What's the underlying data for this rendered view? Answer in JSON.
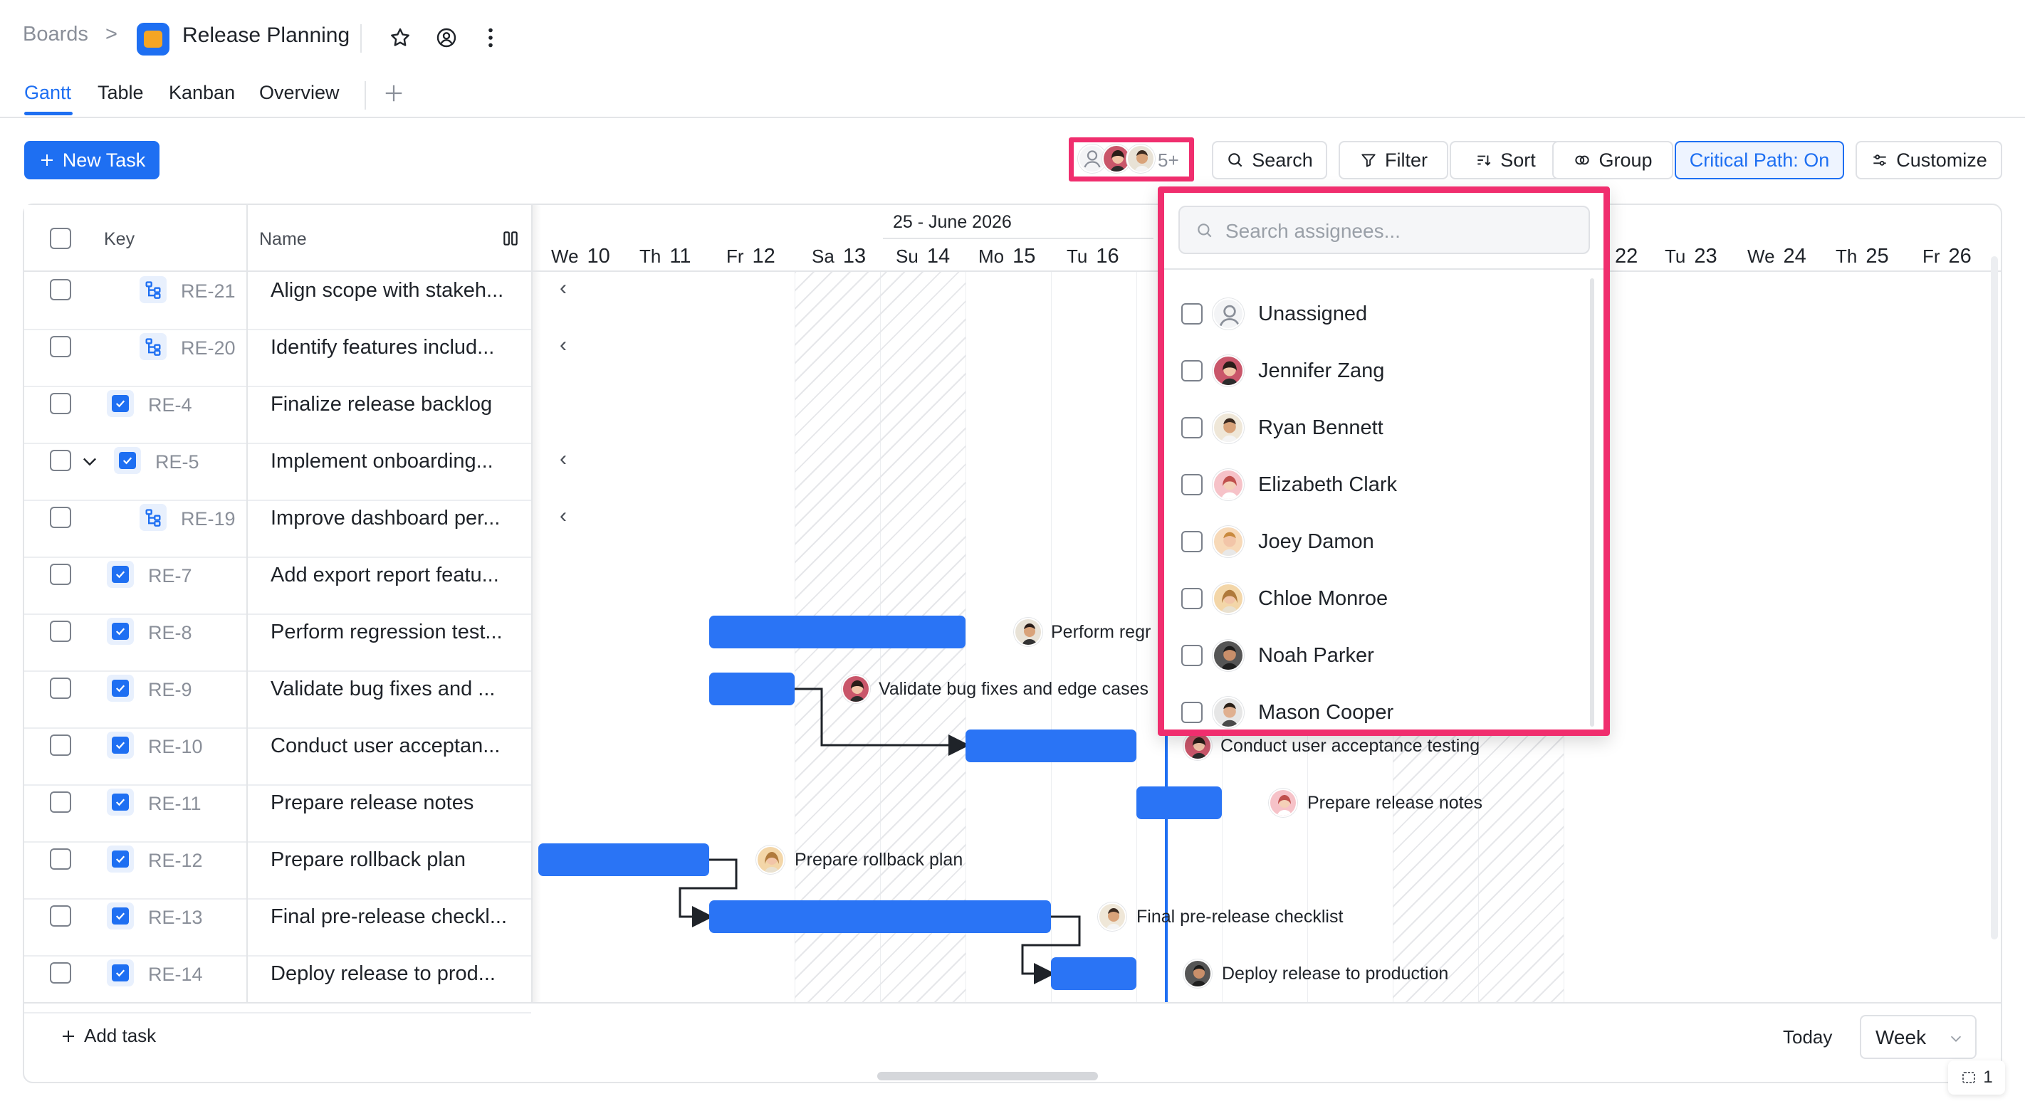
{
  "breadcrumb": {
    "root": "Boards",
    "separator": ">",
    "title": "Release Planning"
  },
  "tabs": [
    {
      "label": "Gantt",
      "active": true
    },
    {
      "label": "Table",
      "active": false
    },
    {
      "label": "Kanban",
      "active": false
    },
    {
      "label": "Overview",
      "active": false
    }
  ],
  "toolbar": {
    "new_task": "New Task",
    "assignee_overflow": "5+",
    "search": "Search",
    "filter": "Filter",
    "sort": "Sort",
    "group": "Group",
    "critical_path": "Critical Path: On",
    "customize": "Customize"
  },
  "table": {
    "key_header": "Key",
    "name_header": "Name",
    "rows": [
      {
        "key": "RE-21",
        "name": "Align scope with stakeh...",
        "type": "subtask",
        "indent": true
      },
      {
        "key": "RE-20",
        "name": "Identify features includ...",
        "type": "subtask",
        "indent": true
      },
      {
        "key": "RE-4",
        "name": "Finalize release backlog",
        "type": "task",
        "indent": false
      },
      {
        "key": "RE-5",
        "name": "Implement onboarding...",
        "type": "task",
        "indent": false,
        "expandable": true
      },
      {
        "key": "RE-19",
        "name": "Improve dashboard per...",
        "type": "subtask",
        "indent": true
      },
      {
        "key": "RE-7",
        "name": "Add export report featu...",
        "type": "task",
        "indent": false
      },
      {
        "key": "RE-8",
        "name": "Perform regression test...",
        "type": "task",
        "indent": false
      },
      {
        "key": "RE-9",
        "name": "Validate bug fixes and ...",
        "type": "task",
        "indent": false
      },
      {
        "key": "RE-10",
        "name": "Conduct user acceptan...",
        "type": "task",
        "indent": false
      },
      {
        "key": "RE-11",
        "name": "Prepare release notes",
        "type": "task",
        "indent": false
      },
      {
        "key": "RE-12",
        "name": "Prepare rollback plan",
        "type": "task",
        "indent": false
      },
      {
        "key": "RE-13",
        "name": "Final pre-release checkl...",
        "type": "task",
        "indent": false
      },
      {
        "key": "RE-14",
        "name": "Deploy release to prod...",
        "type": "task",
        "indent": false
      }
    ],
    "add_task": "Add task"
  },
  "gantt": {
    "week_label": "25 - June 2026",
    "days": [
      {
        "abbr": "We",
        "num": "10"
      },
      {
        "abbr": "Th",
        "num": "11"
      },
      {
        "abbr": "Fr",
        "num": "12"
      },
      {
        "abbr": "Sa",
        "num": "13"
      },
      {
        "abbr": "Su",
        "num": "14"
      },
      {
        "abbr": "Mo",
        "num": "15"
      },
      {
        "abbr": "Tu",
        "num": "16"
      },
      {
        "abbr": "",
        "num": "22"
      },
      {
        "abbr": "Tu",
        "num": "23"
      },
      {
        "abbr": "We",
        "num": "24"
      },
      {
        "abbr": "Th",
        "num": "25"
      },
      {
        "abbr": "Fr",
        "num": "26"
      }
    ],
    "bar_labels": {
      "re8": "Perform regr",
      "re9": "Validate bug fixes and edge cases",
      "re10": "Conduct user acceptance testing",
      "re11": "Prepare release notes",
      "re12": "Prepare rollback plan",
      "re13": "Final pre-release checklist",
      "re14": "Deploy release to production"
    },
    "bar_color": "#2a74f5"
  },
  "footer": {
    "today": "Today",
    "zoom": "Week",
    "badge_count": "1"
  },
  "assignee_popup": {
    "placeholder": "Search assignees...",
    "items": [
      {
        "name": "Unassigned"
      },
      {
        "name": "Jennifer Zang"
      },
      {
        "name": "Ryan Bennett"
      },
      {
        "name": "Elizabeth Clark"
      },
      {
        "name": "Joey Damon"
      },
      {
        "name": "Chloe Monroe"
      },
      {
        "name": "Noah Parker"
      },
      {
        "name": "Mason Cooper"
      }
    ]
  },
  "colors": {
    "accent": "#1e6ff2",
    "highlight": "#f02e6e"
  }
}
